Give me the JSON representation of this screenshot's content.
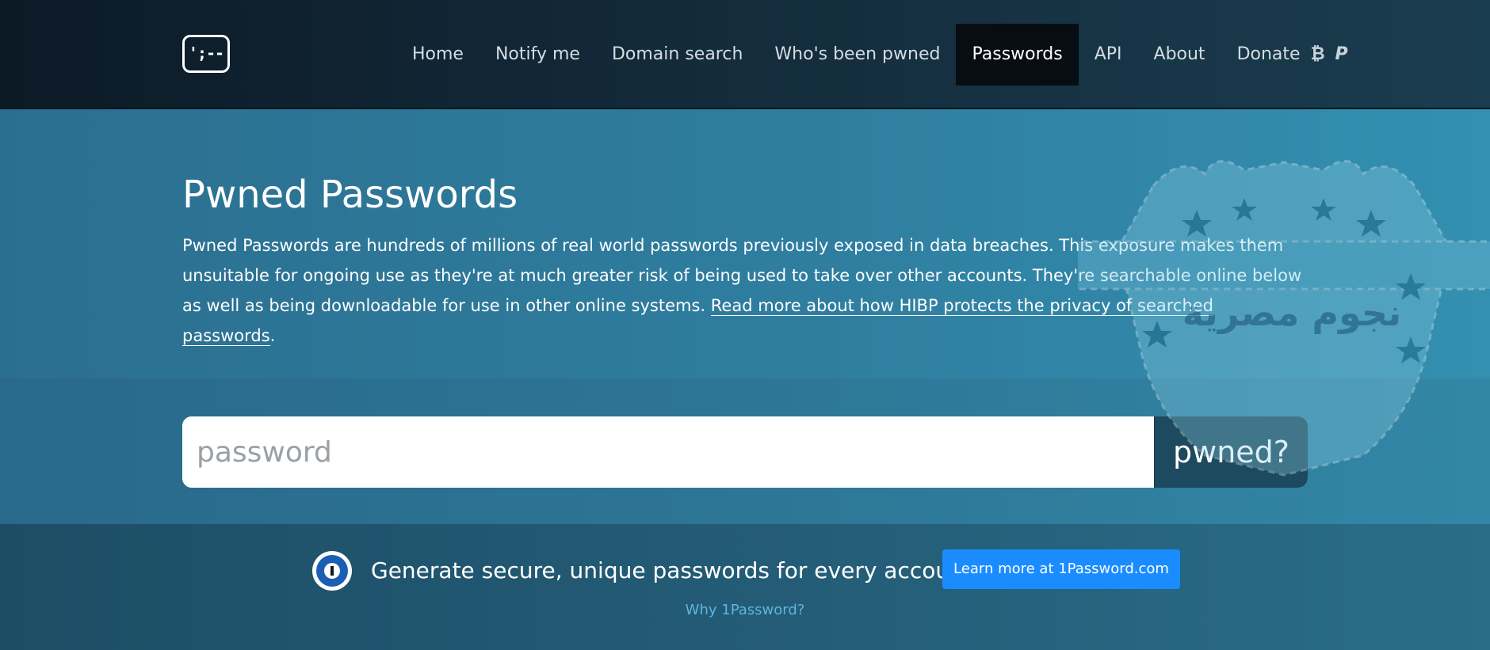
{
  "nav": {
    "logo_text": "';--",
    "items": [
      {
        "label": "Home"
      },
      {
        "label": "Notify me"
      },
      {
        "label": "Domain search"
      },
      {
        "label": "Who's been pwned"
      },
      {
        "label": "Passwords",
        "active": true
      },
      {
        "label": "API"
      },
      {
        "label": "About"
      },
      {
        "label": "Donate"
      }
    ],
    "donate_icons": [
      "bitcoin-icon",
      "paypal-icon"
    ]
  },
  "hero": {
    "title": "Pwned Passwords",
    "description": "Pwned Passwords are hundreds of millions of real world passwords previously exposed in data breaches. This exposure makes them unsuitable for ongoing use as they're at much greater risk of being used to take over other accounts. They're searchable online below as well as being downloadable for use in other online systems.",
    "link_text": "Read more about how HIBP protects the privacy of searched passwords"
  },
  "search": {
    "placeholder": "password",
    "value": "",
    "button_label": "pwned?"
  },
  "promo": {
    "text": "Generate secure, unique passwords for every account",
    "button_label": "Learn more at 1Password.com",
    "secondary_link": "Why 1Password?"
  },
  "watermark": {
    "text": "نجوم مصرية"
  },
  "colors": {
    "navbar_bg": "#132a3a",
    "active_nav_bg": "#070d12",
    "hero_bg": "#2f7ea0",
    "pwned_button_bg": "#1d4a5e",
    "promo_button_bg": "#1a8cff",
    "link_color": "#5bb6e0"
  }
}
